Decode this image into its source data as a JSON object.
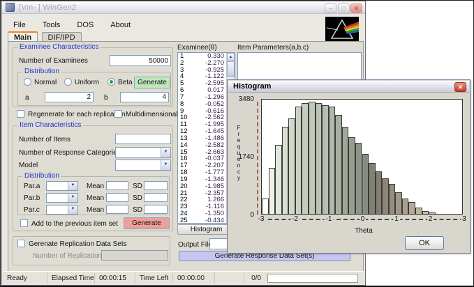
{
  "window": {
    "title": "[Vm- ] WinGen2",
    "menu": [
      "File",
      "Tools",
      "DOS",
      "About"
    ],
    "tabs": [
      "Main",
      "DIF/IPD"
    ],
    "active_tab": "Main"
  },
  "examinee_section": {
    "title": "Examinee Characteristics",
    "num_examinees_label": "Number of Examinees",
    "num_examinees_value": "50000",
    "distribution": {
      "title": "Distribution",
      "options": [
        "Normal",
        "Uniform",
        "Beta"
      ],
      "selected": "Beta",
      "generate_label": "Generate",
      "a_label": "a",
      "a_value": "2",
      "b_label": "b",
      "b_value": "4"
    },
    "regenerate_label": "Regenerate for each replication",
    "multidimensional_label": "Multidimensional"
  },
  "item_section": {
    "title": "Item Characteristics",
    "num_items_label": "Number of Items",
    "num_response_label": "Number of Response Categories",
    "model_label": "Model",
    "distribution": {
      "title": "Distribution",
      "rows": [
        {
          "label": "Par.a"
        },
        {
          "label": "Par.b"
        },
        {
          "label": "Par.c"
        }
      ],
      "mean_label": "Mean",
      "sd_label": "SD"
    },
    "add_previous_label": "Add to the previous item set",
    "generate_label": "Generate"
  },
  "replication_section": {
    "checkbox_label": "Gerenate Replication Data Sets",
    "num_replications_label": "Number of Replications"
  },
  "examinee_list": {
    "header": "Examinee(θ)",
    "items": [
      {
        "n": "1",
        "v": "0.330"
      },
      {
        "n": "2",
        "v": "-2.270"
      },
      {
        "n": "3",
        "v": "-0.925"
      },
      {
        "n": "4",
        "v": "-1.122"
      },
      {
        "n": "5",
        "v": "-2.595"
      },
      {
        "n": "6",
        "v": "0.017"
      },
      {
        "n": "7",
        "v": "-1.296"
      },
      {
        "n": "8",
        "v": "-0.052"
      },
      {
        "n": "9",
        "v": "-0.616"
      },
      {
        "n": "10",
        "v": "-2.562"
      },
      {
        "n": "11",
        "v": "-1.995"
      },
      {
        "n": "12",
        "v": "-1.645"
      },
      {
        "n": "13",
        "v": "-1.486"
      },
      {
        "n": "14",
        "v": "-2.582"
      },
      {
        "n": "15",
        "v": "-2.663"
      },
      {
        "n": "16",
        "v": "-0.037"
      },
      {
        "n": "17",
        "v": "-2.207"
      },
      {
        "n": "18",
        "v": "-1.777"
      },
      {
        "n": "19",
        "v": "-1.346"
      },
      {
        "n": "20",
        "v": "-1.985"
      },
      {
        "n": "21",
        "v": "-2.357"
      },
      {
        "n": "22",
        "v": "1.266"
      },
      {
        "n": "23",
        "v": "-1.116"
      },
      {
        "n": "24",
        "v": "-1.350"
      },
      {
        "n": "25",
        "v": "-0.434"
      }
    ]
  },
  "item_params": {
    "header": "Item Parameters(a,b,c)"
  },
  "actions": {
    "histogram_button": "Histogram",
    "output_file_label": "Output File",
    "generate_response_label": "Generate Response Data Set(s)"
  },
  "statusbar": {
    "ready": "Ready",
    "elapsed_label": "Elapsed Time",
    "elapsed_value": "00:00:15",
    "timeleft_label": "Time Left",
    "timeleft_value": "00:00:00",
    "progress_text": "0/0"
  },
  "histogram_window": {
    "title": "Histogram",
    "ok_label": "OK"
  },
  "colors": {
    "generate_examinee_button": "#bfe8b8",
    "generate_item_button": "#eda09a",
    "generate_response_button": "#c6c6ee",
    "groupbox_title": "#1a35cf",
    "close_button": "#c43a28"
  },
  "chart_data": {
    "type": "bar",
    "title": "Histogram",
    "xlabel": "Theta",
    "ylabel": "Frequency",
    "ylim": [
      0,
      3480
    ],
    "yticks": [
      3480,
      1740,
      0
    ],
    "xticks": [
      -3,
      -2,
      -1,
      0,
      1,
      2,
      3
    ],
    "x_range": [
      -3,
      3
    ],
    "bin_start": -3,
    "bin_width": 0.2,
    "values": [
      466,
      1399,
      2102,
      2655,
      2906,
      3264,
      3372,
      3408,
      3372,
      3315,
      3264,
      3013,
      2655,
      2332,
      2167,
      1830,
      1557,
      1291,
      1090,
      911,
      667,
      466,
      359,
      194,
      86,
      36
    ],
    "bar_colors": [
      "#ffffff",
      "#eef2ea",
      "#e2e8de",
      "#d8e0d4",
      "#cfd8cb",
      "#c9d2c5",
      "#c4cdc0",
      "#bfc8bb",
      "#bac3b6",
      "#b5beb1",
      "#b0b8ac",
      "#a8b0a4",
      "#9fa69a",
      "#969d91",
      "#8d9488",
      "#858b80",
      "#7e8278",
      "#837e74",
      "#8c857a",
      "#968e82",
      "#a0978a",
      "#aaa092",
      "#b4a99a",
      "#beb2a2",
      "#c8bbaa",
      "#d2c4b2"
    ],
    "grid": false,
    "legend": false
  }
}
